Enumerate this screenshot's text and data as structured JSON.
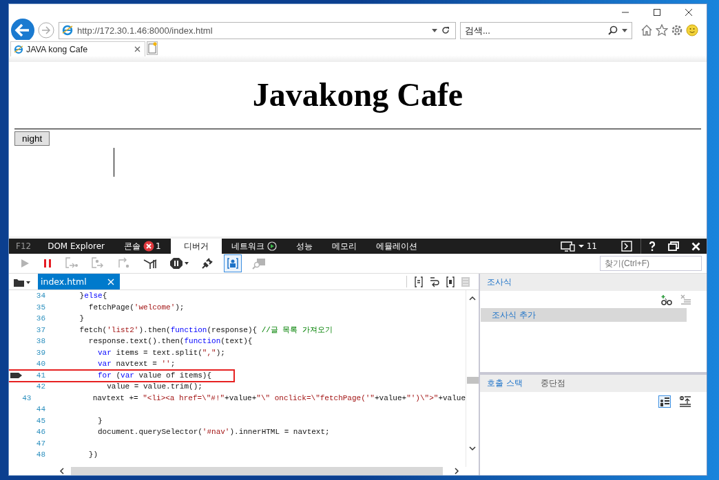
{
  "address_bar": {
    "url": "http://172.30.1.46:8000/index.html"
  },
  "search_box": {
    "placeholder": "검색..."
  },
  "browser_tabs": [
    {
      "title": "JAVA kong Cafe",
      "selected": true
    }
  ],
  "page": {
    "heading": "Javakong Cafe",
    "button": "night"
  },
  "devtools": {
    "tabs": [
      {
        "label": "F12",
        "kind": "label"
      },
      {
        "label": "DOM Explorer",
        "kind": "tab",
        "selected": false
      },
      {
        "label": "콘솔",
        "kind": "errors",
        "badge": "1",
        "selected": false
      },
      {
        "label": "디버거",
        "kind": "tab",
        "selected": true
      },
      {
        "label": "네트워크",
        "kind": "record",
        "selected": false
      },
      {
        "label": "성능",
        "kind": "tab",
        "selected": false
      },
      {
        "label": "메모리",
        "kind": "tab",
        "selected": false
      },
      {
        "label": "에뮬레이션",
        "kind": "tab",
        "selected": false
      }
    ],
    "document_mode": "11",
    "toolbar": [
      {
        "kind": "continue",
        "disabled": true,
        "on": false
      },
      {
        "kind": "break",
        "disabled": false,
        "on": false
      },
      {
        "kind": "step-into",
        "disabled": true,
        "on": false
      },
      {
        "kind": "step-over",
        "disabled": true,
        "on": false
      },
      {
        "kind": "step-out",
        "disabled": true,
        "on": false
      },
      {
        "kind": "worker",
        "disabled": false,
        "on": false
      },
      {
        "kind": "exceptions",
        "disabled": false,
        "on": false
      },
      {
        "kind": "disconnect",
        "disabled": false,
        "on": false
      },
      {
        "kind": "just-my-code",
        "disabled": false,
        "on": true
      },
      {
        "kind": "find-source",
        "disabled": true,
        "on": false
      }
    ],
    "find": {
      "placeholder": "찾기(Ctrl+F)"
    },
    "file_tabs": [
      {
        "label": "index.html",
        "selected": true
      }
    ],
    "code_lines": [
      {
        "number": "34",
        "tokens": [
          {
            "kind": "plain",
            "text": "      }"
          },
          {
            "kind": "keyword",
            "text": "else"
          },
          {
            "kind": "plain",
            "text": "{"
          }
        ]
      },
      {
        "number": "35",
        "tokens": [
          {
            "kind": "plain",
            "text": "        fetchPage("
          },
          {
            "kind": "string",
            "text": "'welcome'"
          },
          {
            "kind": "plain",
            "text": ");"
          }
        ]
      },
      {
        "number": "36",
        "tokens": [
          {
            "kind": "plain",
            "text": "      }"
          }
        ]
      },
      {
        "number": "37",
        "tokens": [
          {
            "kind": "plain",
            "text": "      fetch("
          },
          {
            "kind": "string",
            "text": "'list2'"
          },
          {
            "kind": "plain",
            "text": ").then("
          },
          {
            "kind": "keyword",
            "text": "function"
          },
          {
            "kind": "plain",
            "text": "(response){ "
          },
          {
            "kind": "comment",
            "text": "//글 목록 가져오기"
          }
        ]
      },
      {
        "number": "38",
        "tokens": [
          {
            "kind": "plain",
            "text": "        response.text().then("
          },
          {
            "kind": "keyword",
            "text": "function"
          },
          {
            "kind": "plain",
            "text": "(text){"
          }
        ]
      },
      {
        "number": "39",
        "tokens": [
          {
            "kind": "keyword",
            "text": "          var"
          },
          {
            "kind": "plain",
            "text": " items = text.split("
          },
          {
            "kind": "string",
            "text": "\",\""
          },
          {
            "kind": "plain",
            "text": ");"
          }
        ]
      },
      {
        "number": "40",
        "tokens": [
          {
            "kind": "keyword",
            "text": "          var"
          },
          {
            "kind": "plain",
            "text": " navtext = "
          },
          {
            "kind": "string",
            "text": "''"
          },
          {
            "kind": "plain",
            "text": ";"
          }
        ]
      },
      {
        "number": "41",
        "current": true,
        "highlighted": true,
        "tokens": [
          {
            "kind": "keyword",
            "text": "          for"
          },
          {
            "kind": "plain",
            "text": " ("
          },
          {
            "kind": "keyword",
            "text": "var"
          },
          {
            "kind": "plain",
            "text": " value of items){"
          }
        ]
      },
      {
        "number": "42",
        "tokens": [
          {
            "kind": "plain",
            "text": "            value = value.trim();"
          }
        ]
      },
      {
        "number": "43",
        "tokens": [
          {
            "kind": "plain",
            "text": "            navtext += "
          },
          {
            "kind": "string",
            "text": "\"<li><a href=\\\"#!\""
          },
          {
            "kind": "plain",
            "text": "+value+"
          },
          {
            "kind": "string",
            "text": "\"\\\" onclick=\\\"fetchPage('\""
          },
          {
            "kind": "plain",
            "text": "+value+"
          },
          {
            "kind": "string",
            "text": "\"')\\\">\""
          },
          {
            "kind": "plain",
            "text": "+value"
          }
        ]
      },
      {
        "number": "44"
      },
      {
        "number": "45",
        "tokens": [
          {
            "kind": "plain",
            "text": "          }"
          }
        ]
      },
      {
        "number": "46",
        "tokens": [
          {
            "kind": "plain",
            "text": "          document.querySelector("
          },
          {
            "kind": "string",
            "text": "'#nav'"
          },
          {
            "kind": "plain",
            "text": ").innerHTML = navtext;"
          }
        ]
      },
      {
        "number": "47"
      },
      {
        "number": "48",
        "tokens": [
          {
            "kind": "plain",
            "text": "        })"
          }
        ]
      }
    ],
    "watch": {
      "title": "조사식",
      "add_row": "조사식 추가"
    },
    "bottom_tabs": [
      {
        "label": "호출 스택",
        "selected": true
      },
      {
        "label": "중단점",
        "selected": false
      }
    ]
  }
}
